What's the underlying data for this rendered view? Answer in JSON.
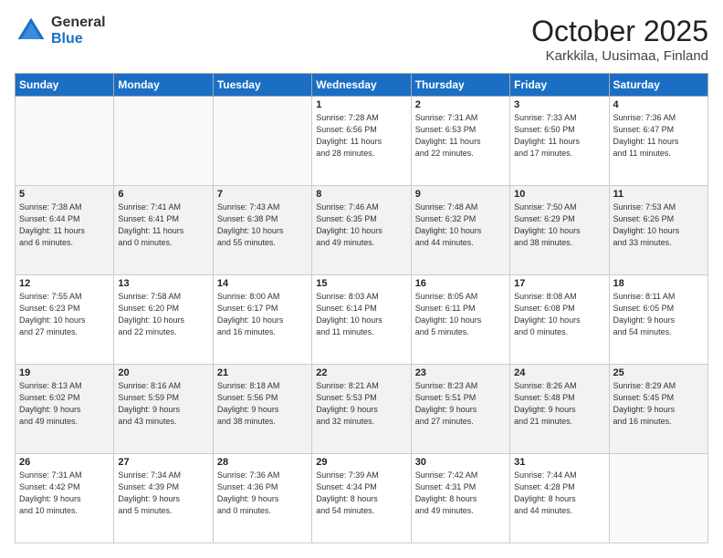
{
  "header": {
    "logo_general": "General",
    "logo_blue": "Blue",
    "month": "October 2025",
    "location": "Karkkila, Uusimaa, Finland"
  },
  "weekdays": [
    "Sunday",
    "Monday",
    "Tuesday",
    "Wednesday",
    "Thursday",
    "Friday",
    "Saturday"
  ],
  "weeks": [
    [
      {
        "day": "",
        "info": ""
      },
      {
        "day": "",
        "info": ""
      },
      {
        "day": "",
        "info": ""
      },
      {
        "day": "1",
        "info": "Sunrise: 7:28 AM\nSunset: 6:56 PM\nDaylight: 11 hours\nand 28 minutes."
      },
      {
        "day": "2",
        "info": "Sunrise: 7:31 AM\nSunset: 6:53 PM\nDaylight: 11 hours\nand 22 minutes."
      },
      {
        "day": "3",
        "info": "Sunrise: 7:33 AM\nSunset: 6:50 PM\nDaylight: 11 hours\nand 17 minutes."
      },
      {
        "day": "4",
        "info": "Sunrise: 7:36 AM\nSunset: 6:47 PM\nDaylight: 11 hours\nand 11 minutes."
      }
    ],
    [
      {
        "day": "5",
        "info": "Sunrise: 7:38 AM\nSunset: 6:44 PM\nDaylight: 11 hours\nand 6 minutes."
      },
      {
        "day": "6",
        "info": "Sunrise: 7:41 AM\nSunset: 6:41 PM\nDaylight: 11 hours\nand 0 minutes."
      },
      {
        "day": "7",
        "info": "Sunrise: 7:43 AM\nSunset: 6:38 PM\nDaylight: 10 hours\nand 55 minutes."
      },
      {
        "day": "8",
        "info": "Sunrise: 7:46 AM\nSunset: 6:35 PM\nDaylight: 10 hours\nand 49 minutes."
      },
      {
        "day": "9",
        "info": "Sunrise: 7:48 AM\nSunset: 6:32 PM\nDaylight: 10 hours\nand 44 minutes."
      },
      {
        "day": "10",
        "info": "Sunrise: 7:50 AM\nSunset: 6:29 PM\nDaylight: 10 hours\nand 38 minutes."
      },
      {
        "day": "11",
        "info": "Sunrise: 7:53 AM\nSunset: 6:26 PM\nDaylight: 10 hours\nand 33 minutes."
      }
    ],
    [
      {
        "day": "12",
        "info": "Sunrise: 7:55 AM\nSunset: 6:23 PM\nDaylight: 10 hours\nand 27 minutes."
      },
      {
        "day": "13",
        "info": "Sunrise: 7:58 AM\nSunset: 6:20 PM\nDaylight: 10 hours\nand 22 minutes."
      },
      {
        "day": "14",
        "info": "Sunrise: 8:00 AM\nSunset: 6:17 PM\nDaylight: 10 hours\nand 16 minutes."
      },
      {
        "day": "15",
        "info": "Sunrise: 8:03 AM\nSunset: 6:14 PM\nDaylight: 10 hours\nand 11 minutes."
      },
      {
        "day": "16",
        "info": "Sunrise: 8:05 AM\nSunset: 6:11 PM\nDaylight: 10 hours\nand 5 minutes."
      },
      {
        "day": "17",
        "info": "Sunrise: 8:08 AM\nSunset: 6:08 PM\nDaylight: 10 hours\nand 0 minutes."
      },
      {
        "day": "18",
        "info": "Sunrise: 8:11 AM\nSunset: 6:05 PM\nDaylight: 9 hours\nand 54 minutes."
      }
    ],
    [
      {
        "day": "19",
        "info": "Sunrise: 8:13 AM\nSunset: 6:02 PM\nDaylight: 9 hours\nand 49 minutes."
      },
      {
        "day": "20",
        "info": "Sunrise: 8:16 AM\nSunset: 5:59 PM\nDaylight: 9 hours\nand 43 minutes."
      },
      {
        "day": "21",
        "info": "Sunrise: 8:18 AM\nSunset: 5:56 PM\nDaylight: 9 hours\nand 38 minutes."
      },
      {
        "day": "22",
        "info": "Sunrise: 8:21 AM\nSunset: 5:53 PM\nDaylight: 9 hours\nand 32 minutes."
      },
      {
        "day": "23",
        "info": "Sunrise: 8:23 AM\nSunset: 5:51 PM\nDaylight: 9 hours\nand 27 minutes."
      },
      {
        "day": "24",
        "info": "Sunrise: 8:26 AM\nSunset: 5:48 PM\nDaylight: 9 hours\nand 21 minutes."
      },
      {
        "day": "25",
        "info": "Sunrise: 8:29 AM\nSunset: 5:45 PM\nDaylight: 9 hours\nand 16 minutes."
      }
    ],
    [
      {
        "day": "26",
        "info": "Sunrise: 7:31 AM\nSunset: 4:42 PM\nDaylight: 9 hours\nand 10 minutes."
      },
      {
        "day": "27",
        "info": "Sunrise: 7:34 AM\nSunset: 4:39 PM\nDaylight: 9 hours\nand 5 minutes."
      },
      {
        "day": "28",
        "info": "Sunrise: 7:36 AM\nSunset: 4:36 PM\nDaylight: 9 hours\nand 0 minutes."
      },
      {
        "day": "29",
        "info": "Sunrise: 7:39 AM\nSunset: 4:34 PM\nDaylight: 8 hours\nand 54 minutes."
      },
      {
        "day": "30",
        "info": "Sunrise: 7:42 AM\nSunset: 4:31 PM\nDaylight: 8 hours\nand 49 minutes."
      },
      {
        "day": "31",
        "info": "Sunrise: 7:44 AM\nSunset: 4:28 PM\nDaylight: 8 hours\nand 44 minutes."
      },
      {
        "day": "",
        "info": ""
      }
    ]
  ]
}
